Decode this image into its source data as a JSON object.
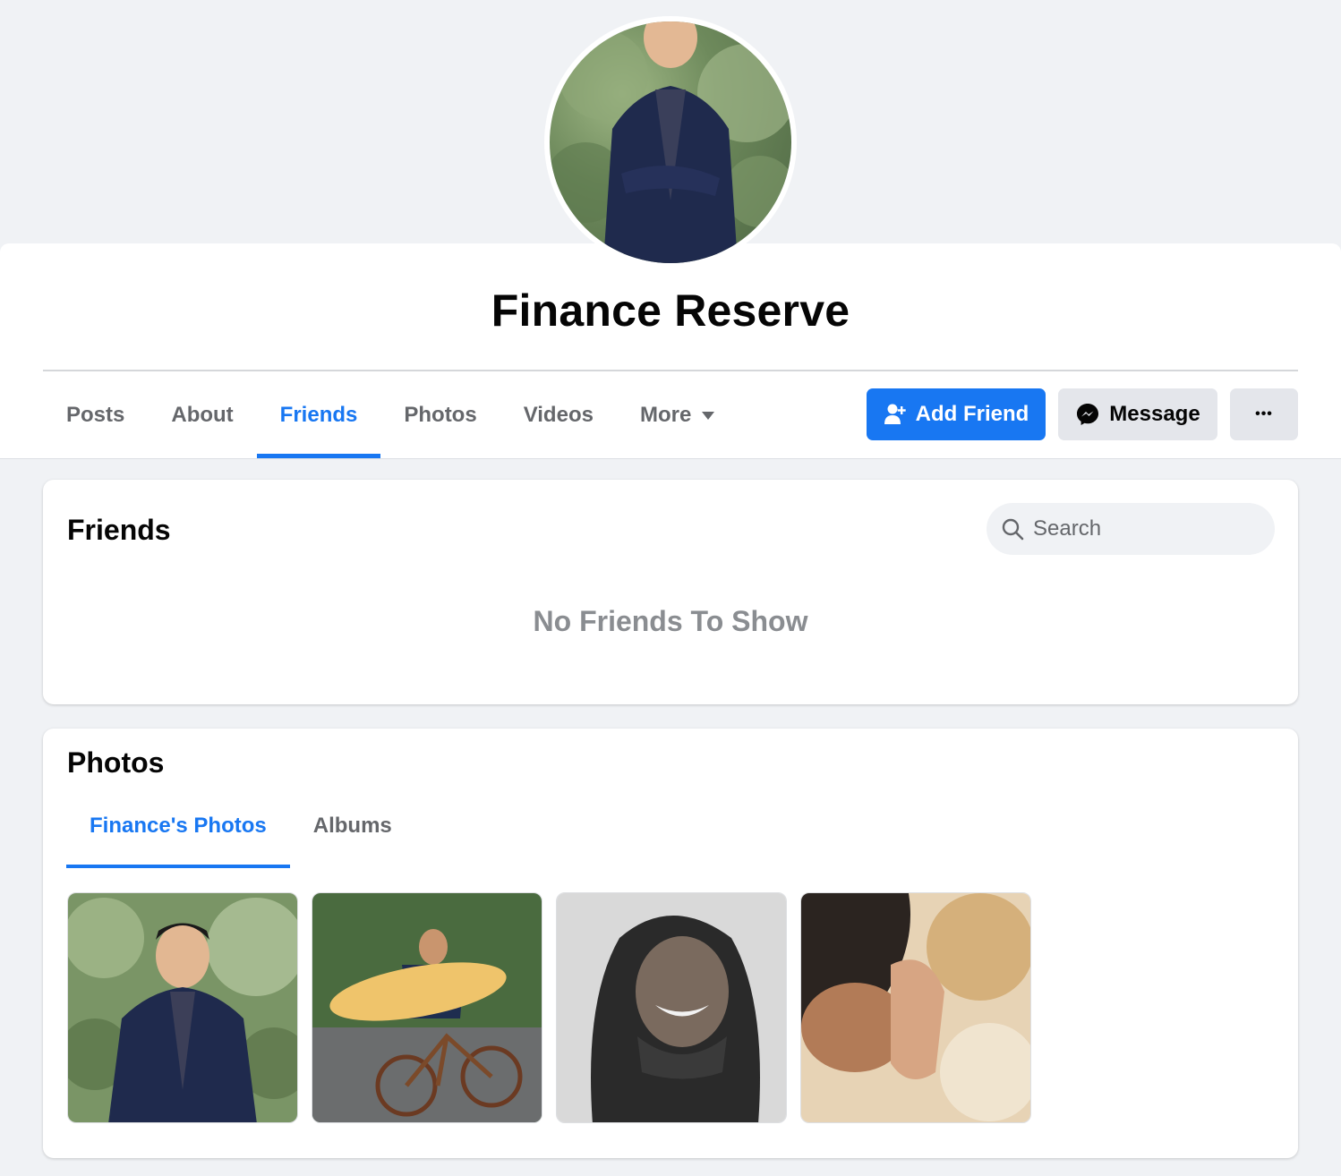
{
  "profile": {
    "name": "Finance Reserve"
  },
  "nav": {
    "tabs": [
      {
        "label": "Posts",
        "active": false
      },
      {
        "label": "About",
        "active": false
      },
      {
        "label": "Friends",
        "active": true
      },
      {
        "label": "Photos",
        "active": false
      },
      {
        "label": "Videos",
        "active": false
      },
      {
        "label": "More",
        "active": false
      }
    ]
  },
  "actions": {
    "add_friend_label": "Add Friend",
    "message_label": "Message",
    "more_label": "•••"
  },
  "friends_section": {
    "title": "Friends",
    "search_placeholder": "Search",
    "empty_message": "No Friends To Show"
  },
  "photos_section": {
    "title": "Photos",
    "tabs": [
      {
        "label": "Finance's Photos",
        "active": true
      },
      {
        "label": "Albums",
        "active": false
      }
    ],
    "photos": [
      "man-in-suit",
      "man-with-surfboard-on-bike",
      "man-with-dreadlocks",
      "person-praying"
    ]
  },
  "colors": {
    "accent": "#1877f2",
    "background": "#f0f2f5",
    "secondary_button": "#e4e6eb",
    "muted_text": "#65676b"
  }
}
